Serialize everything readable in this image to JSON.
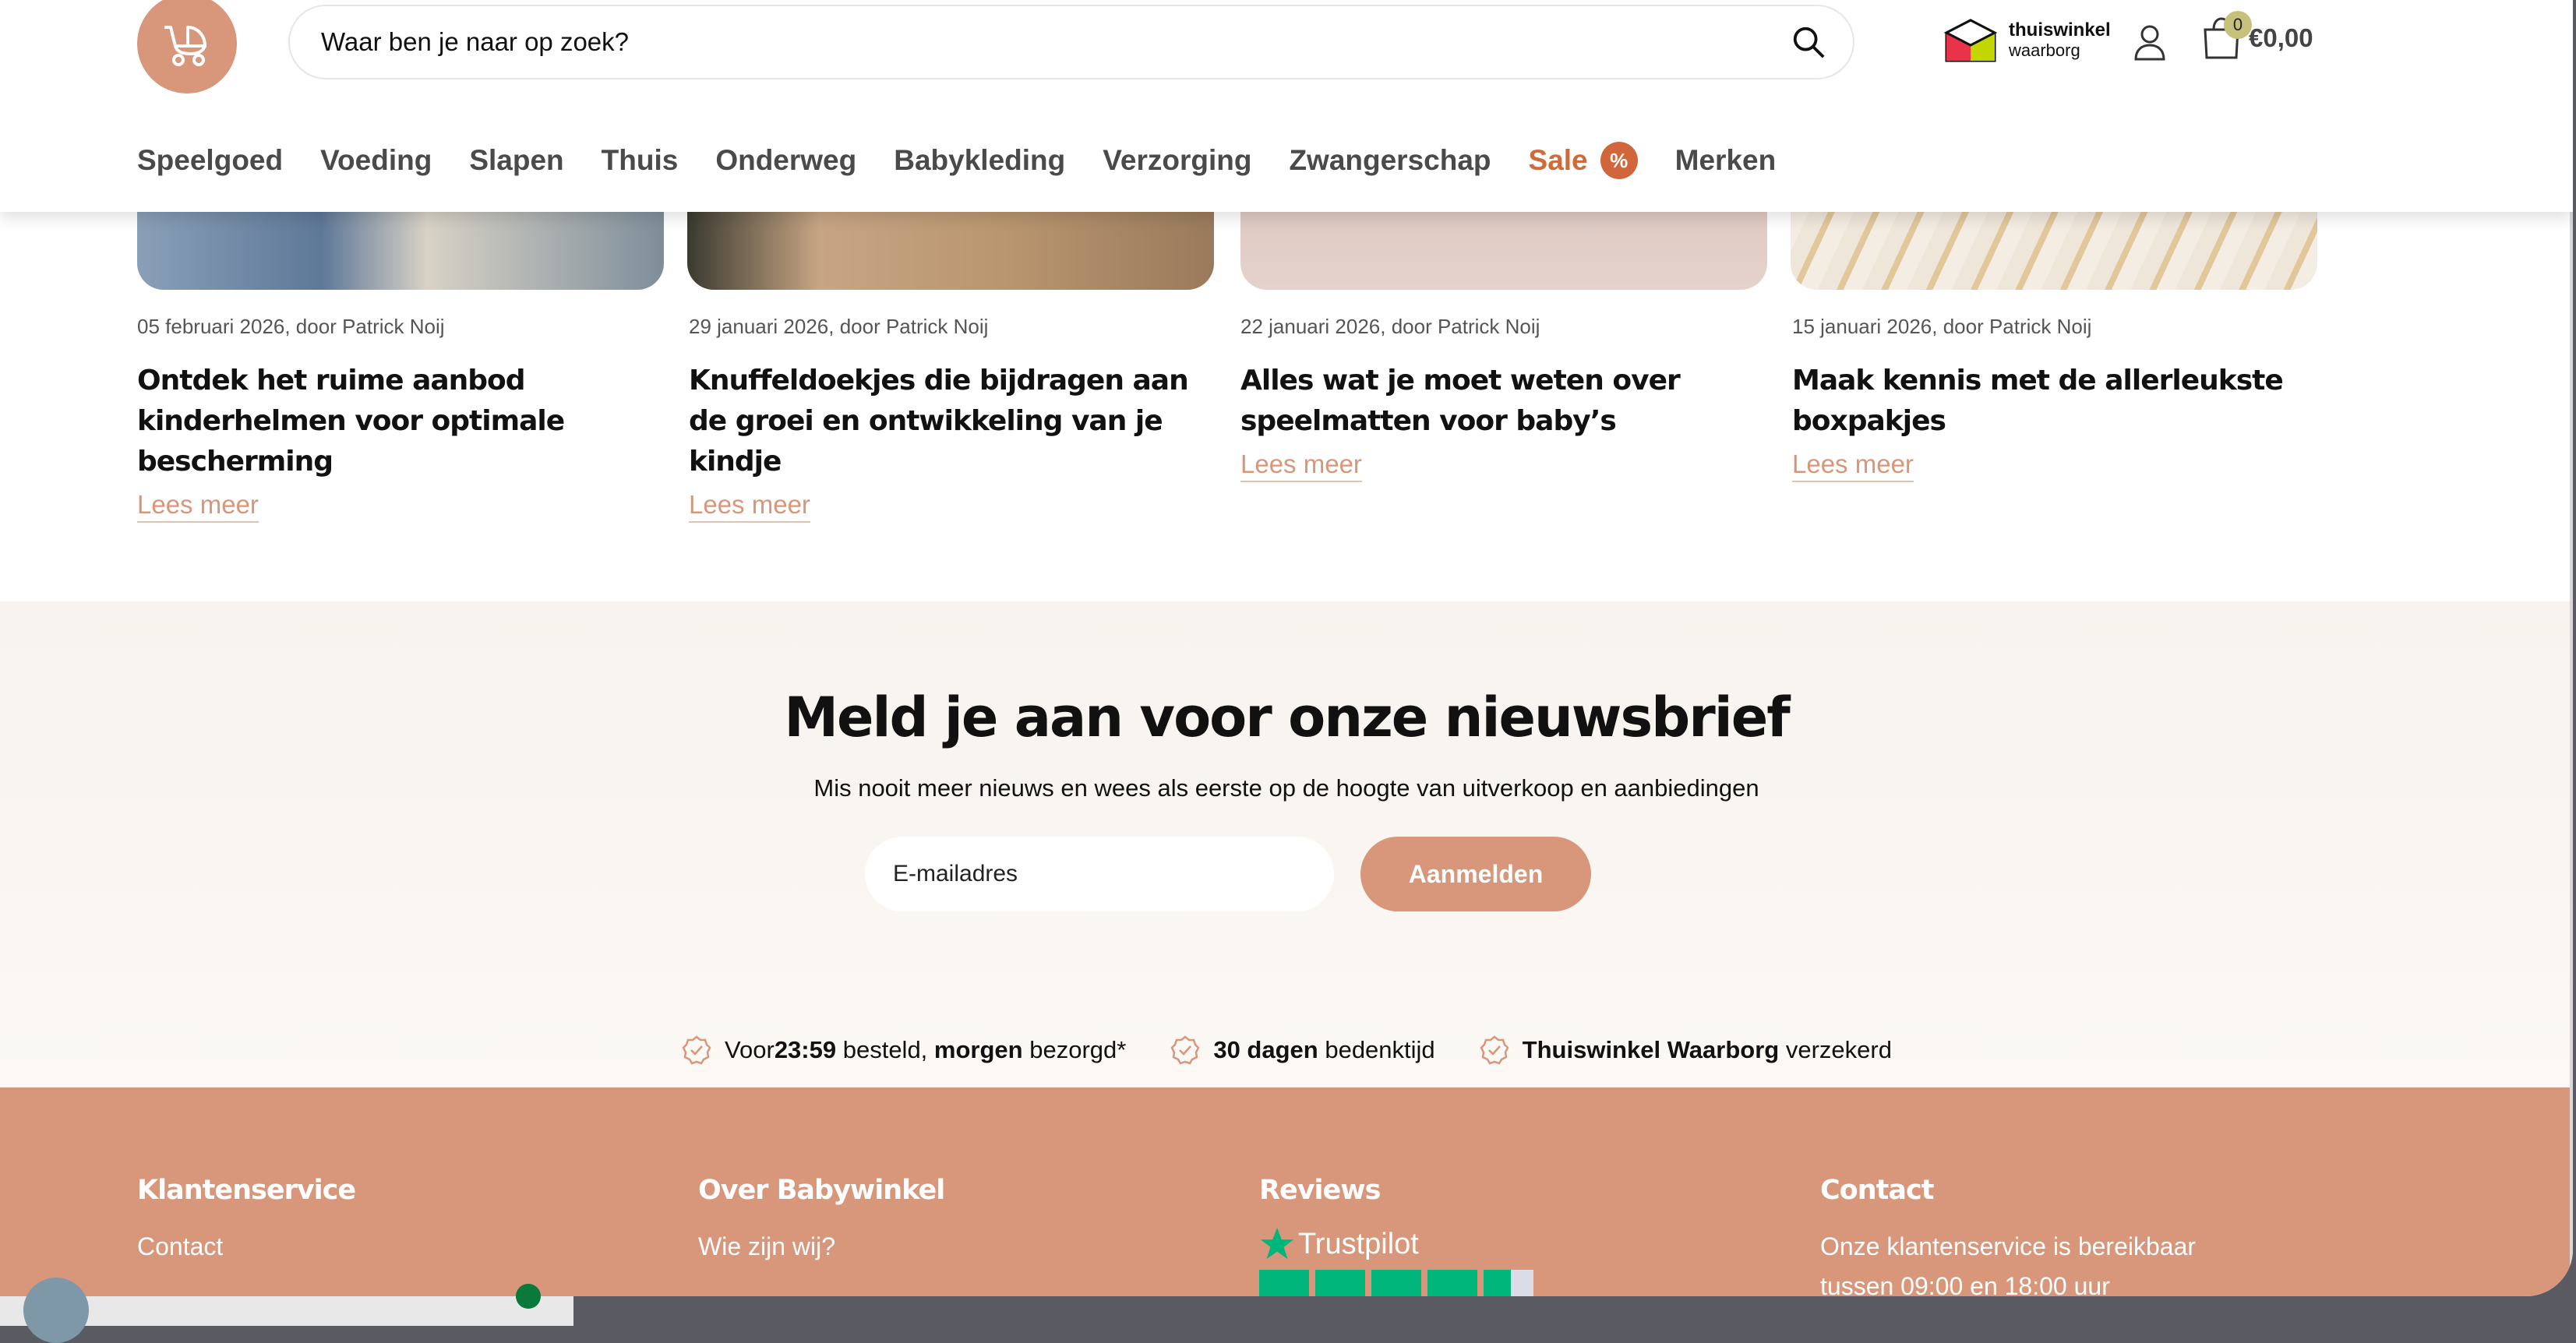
{
  "header": {
    "search_placeholder": "Waar ben je naar op zoek?",
    "thuiswinkel_line1": "thuiswinkel",
    "thuiswinkel_line2": "waarborg",
    "cart_count": "0",
    "cart_total": "€0,00"
  },
  "nav": {
    "items": [
      "Speelgoed",
      "Voeding",
      "Slapen",
      "Thuis",
      "Onderweg",
      "Babykleding",
      "Verzorging",
      "Zwangerschap"
    ],
    "sale_label": "Sale",
    "sale_badge": "%",
    "brands_label": "Merken"
  },
  "blog": [
    {
      "meta": "05 februari 2026, door Patrick Noij",
      "title": "Ontdek het ruime aanbod kinderhelmen voor optimale bescherming",
      "link": "Lees meer"
    },
    {
      "meta": "29 januari 2026, door Patrick Noij",
      "title": "Knuffeldoekjes die bijdragen aan de groei en ontwikkeling van je kindje",
      "link": "Lees meer"
    },
    {
      "meta": "22 januari 2026, door Patrick Noij",
      "title": "Alles wat je moet weten over speelmat­ten voor baby’s",
      "link": "Lees meer"
    },
    {
      "meta": "15 januari 2026, door Patrick Noij",
      "title": "Maak kennis met de allerleukste box­pakjes",
      "link": "Lees meer"
    }
  ],
  "newsletter": {
    "title": "Meld je aan voor onze nieuwsbrief",
    "subtitle": "Mis nooit meer nieuws en wees als eerste op de hoogte van uitverkoop en aanbiedingen",
    "email_placeholder": "E-mailadres",
    "button": "Aanmelden"
  },
  "usps": {
    "u1_a": "Voor ",
    "u1_b": "23:59",
    "u1_c": " besteld, ",
    "u1_d": "morgen",
    "u1_e": " bezorgd*",
    "u2_a": "30 dagen",
    "u2_b": " bedenktijd",
    "u3_a": "Thuiswinkel Waarborg",
    "u3_b": " verzekerd"
  },
  "footer": {
    "col1_title": "Klantenservice",
    "col1_link": "Contact",
    "col2_title": "Over Babywinkel",
    "col2_link": "Wie zijn wij?",
    "col3_title": "Reviews",
    "trustpilot": "Trustpilot",
    "col4_title": "Contact",
    "col4_line1": "Onze klantenservice is bereikbaar",
    "col4_line2": "tussen 09:00 en 18:00 uur"
  },
  "colors": {
    "brand": "#d8967a",
    "sale": "#d0663a",
    "trustpilot": "#00b67a"
  }
}
